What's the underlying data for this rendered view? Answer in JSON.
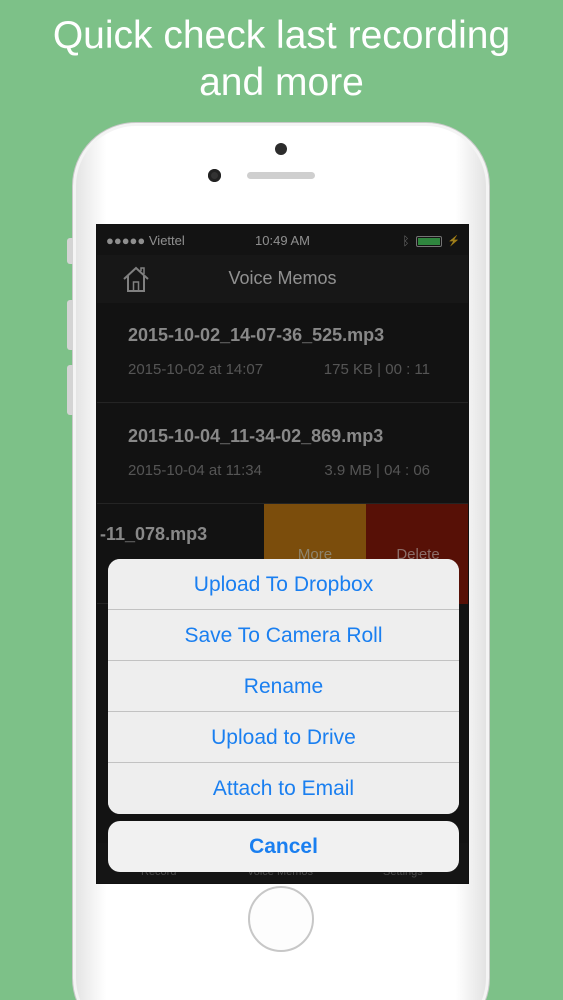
{
  "headline": {
    "line1": "Quick check last recording",
    "line2": "and more"
  },
  "status_bar": {
    "carrier": "●●●●● Viettel",
    "time": "10:49 AM"
  },
  "nav": {
    "title": "Voice Memos",
    "home_icon": "home-icon"
  },
  "recordings": [
    {
      "name": "2015-10-02_14-07-36_525.mp3",
      "date": "2015-10-02 at 14:07",
      "meta": "175 KB | 00 : 11"
    },
    {
      "name": "2015-10-04_11-34-02_869.mp3",
      "date": "2015-10-04 at 11:34",
      "meta": "3.9 MB | 04 : 06"
    }
  ],
  "swiped_row": {
    "name_fragment": "-11_078.mp3",
    "more_label": "More",
    "delete_label": "Delete"
  },
  "tabs": [
    "Record",
    "Voice Memos",
    "Settings"
  ],
  "action_sheet": {
    "items": [
      "Upload To Dropbox",
      "Save To Camera Roll",
      "Rename",
      "Upload to Drive",
      "Attach to Email"
    ],
    "cancel": "Cancel"
  },
  "colors": {
    "background": "#7dc188",
    "accent": "#1a7ff0",
    "more": "#c77d14",
    "delete": "#8d1b0b"
  }
}
